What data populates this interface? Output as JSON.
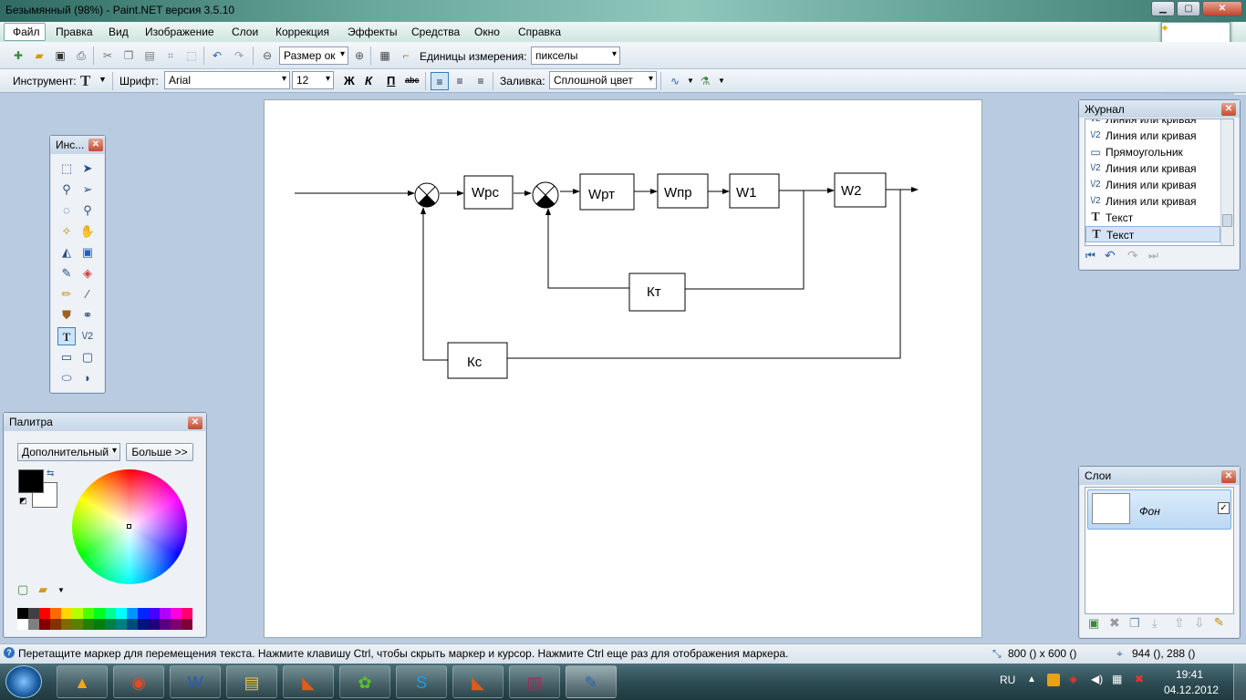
{
  "window": {
    "title": "Безымянный (98%) - Paint.NET версия 3.5.10",
    "min": "▁",
    "max": "▢",
    "close": "✕"
  },
  "menu": [
    "Файл",
    "Правка",
    "Вид",
    "Изображение",
    "Слои",
    "Коррекция",
    "Эффекты",
    "Средства",
    "Окно",
    "Справка"
  ],
  "toolbar1": {
    "zoom_combo": "Размер ок",
    "units_label": "Единицы измерения:",
    "units_value": "пикселы"
  },
  "toolbar2": {
    "tool_label": "Инструмент:",
    "tool_icon": "T",
    "font_label": "Шрифт:",
    "font_value": "Arial",
    "size_value": "12",
    "bold": "Ж",
    "italic": "К",
    "underline": "П",
    "strike": "abc",
    "fill_label": "Заливка:",
    "fill_value": "Сплошной цвет"
  },
  "tools_panel": {
    "title": "Инс...",
    "close": "✕",
    "text_tool_icon": "T",
    "line_tool_icon": "\\/2"
  },
  "palette_panel": {
    "title": "Палитра",
    "close": "✕",
    "mode": "Дополнительный",
    "more": "Больше >>",
    "primary_color": "#000000",
    "secondary_color": "#ffffff",
    "swatches_top": [
      "#000000",
      "#404040",
      "#ff0000",
      "#ff6a00",
      "#ffd800",
      "#b6ff00",
      "#4cff00",
      "#00ff21",
      "#00ff90",
      "#00ffff",
      "#0094ff",
      "#0026ff",
      "#4800ff",
      "#b200ff",
      "#ff00dc",
      "#ff006e"
    ],
    "swatches_bottom": [
      "#ffffff",
      "#808080",
      "#7f0000",
      "#7f3300",
      "#7f6a00",
      "#5b7f00",
      "#267f00",
      "#007f0e",
      "#007f46",
      "#007f7f",
      "#004a7f",
      "#00137f",
      "#21007f",
      "#57007f",
      "#7f006e",
      "#7f0037"
    ]
  },
  "history_panel": {
    "title": "Журнал",
    "close": "✕",
    "items": [
      {
        "icon": "\\/2",
        "label": "Линия или кривая"
      },
      {
        "icon": "\\/2",
        "label": "Линия или кривая"
      },
      {
        "icon": "▭",
        "label": "Прямоугольник"
      },
      {
        "icon": "\\/2",
        "label": "Линия или кривая"
      },
      {
        "icon": "\\/2",
        "label": "Линия или кривая"
      },
      {
        "icon": "\\/2",
        "label": "Линия или кривая"
      },
      {
        "icon": "T",
        "label": "Текст"
      },
      {
        "icon": "T",
        "label": "Текст"
      }
    ]
  },
  "layers_panel": {
    "title": "Слои",
    "close": "✕",
    "layer_name": "Фон",
    "checked": "✓"
  },
  "diagram": {
    "blocks": [
      "Wрс",
      "Wрт",
      "Wпр",
      "W1",
      "W2",
      "Кт",
      "Кс"
    ]
  },
  "status": {
    "hint": "Перетащите маркер для перемещения текста. Нажмите клавишу Ctrl, чтобы скрыть маркер и курсор. Нажмите Ctrl еще раз для отображения маркера.",
    "image_size": "800 () x 600 ()",
    "cursor_pos": "944 (), 288 ()"
  },
  "taskbar": {
    "lang": "RU",
    "time": "19:41",
    "date": "04.12.2012"
  }
}
